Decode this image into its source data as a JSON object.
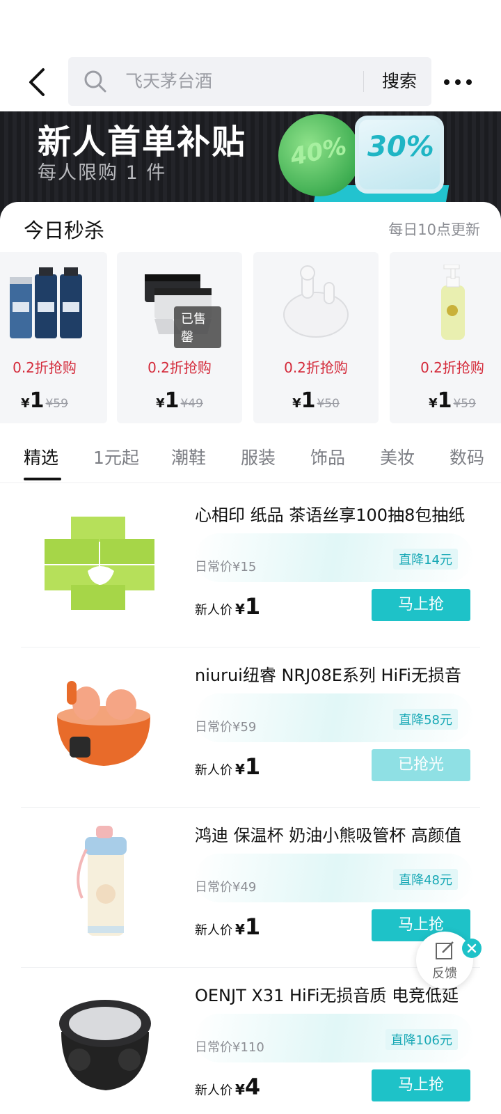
{
  "search": {
    "placeholder": "飞天茅台酒",
    "button_label": "搜索"
  },
  "banner": {
    "title": "新人首单补贴",
    "subtitle": "每人限购 1 件",
    "badge_left": "40%",
    "badge_right": "30%"
  },
  "flash_sale": {
    "title": "今日秒杀",
    "update_note": "每日10点更新",
    "items": [
      {
        "discount": "0.2折抢购",
        "yen": "¥",
        "price": "1",
        "original": "¥59",
        "icon": "skincare-bottles-image"
      },
      {
        "discount": "0.2折抢购",
        "yen": "¥",
        "price": "1",
        "original": "¥49",
        "icon": "underwear-image",
        "sold_out": "已售罄"
      },
      {
        "discount": "0.2折抢购",
        "yen": "¥",
        "price": "1",
        "original": "¥50",
        "icon": "earbuds-image"
      },
      {
        "discount": "0.2折抢购",
        "yen": "¥",
        "price": "1",
        "original": "¥59",
        "icon": "lotion-bottle-image"
      }
    ]
  },
  "tabs": [
    "精选",
    "1元起",
    "潮鞋",
    "服装",
    "饰品",
    "美妆",
    "数码"
  ],
  "products": [
    {
      "title": "心相印 纸品 茶语丝享100抽8包抽纸",
      "daily": "日常价¥15",
      "drop": "直降14元",
      "new_label": "新人价",
      "yen": "¥",
      "price": "1",
      "button": "马上抢"
    },
    {
      "title": "niurui纽睿 NRJ08E系列 HiFi无损音",
      "daily": "日常价¥59",
      "drop": "直降58元",
      "new_label": "新人价",
      "yen": "¥",
      "price": "1",
      "button": "已抢光"
    },
    {
      "title": "鸿迪 保温杯 奶油小熊吸管杯 高颜值",
      "daily": "日常价¥49",
      "drop": "直降48元",
      "new_label": "新人价",
      "yen": "¥",
      "price": "1",
      "button": "马上抢"
    },
    {
      "title": "OENJT X31 HiFi无损音质 电竞低延",
      "daily": "日常价¥110",
      "drop": "直降106元",
      "new_label": "新人价",
      "yen": "¥",
      "price": "4",
      "button": "马上抢"
    }
  ],
  "feedback": {
    "label": "反馈"
  },
  "colors": {
    "accent": "#1ec2c8",
    "discount_red": "#d42a3a",
    "banner_bg": "#1b1c20"
  }
}
